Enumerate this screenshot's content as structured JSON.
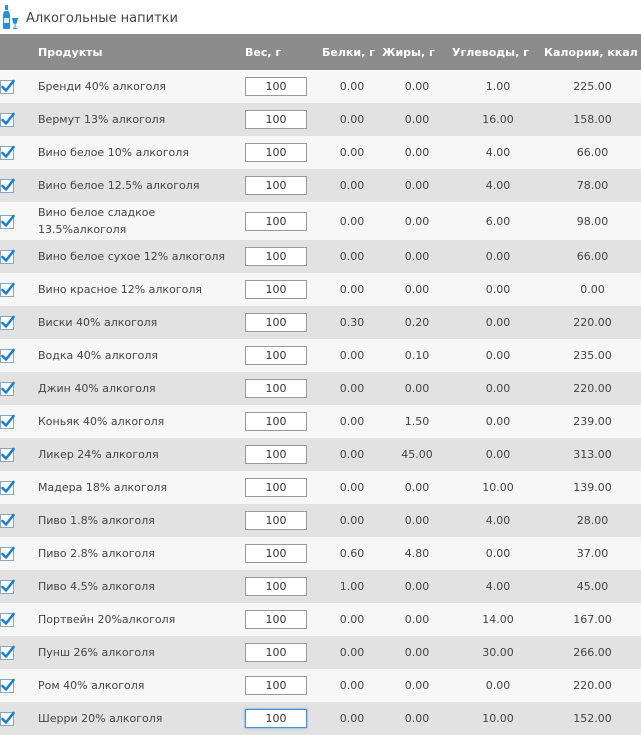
{
  "category": {
    "title": "Алкогольные напитки",
    "icon": "bottle-glass-icon"
  },
  "columns": {
    "product": "Продукты",
    "weight": "Вес, г",
    "protein": "Белки, г",
    "fat": "Жиры, г",
    "carbs": "Углеводы, г",
    "calories": "Калории, ккал"
  },
  "accent_color": "#1a7fd4",
  "rows": [
    {
      "name": "Бренди 40% алкоголя",
      "weight": "100",
      "protein": "0.00",
      "fat": "0.00",
      "carbs": "1.00",
      "calories": "225.00"
    },
    {
      "name": "Вермут 13% алкоголя",
      "weight": "100",
      "protein": "0.00",
      "fat": "0.00",
      "carbs": "16.00",
      "calories": "158.00"
    },
    {
      "name": "Вино белое 10% алкоголя",
      "weight": "100",
      "protein": "0.00",
      "fat": "0.00",
      "carbs": "4.00",
      "calories": "66.00"
    },
    {
      "name": "Вино белое 12.5% алкоголя",
      "weight": "100",
      "protein": "0.00",
      "fat": "0.00",
      "carbs": "4.00",
      "calories": "78.00"
    },
    {
      "name": "Вино белое сладкое 13.5%алкоголя",
      "weight": "100",
      "protein": "0.00",
      "fat": "0.00",
      "carbs": "6.00",
      "calories": "98.00"
    },
    {
      "name": "Вино белое сухое 12% алкоголя",
      "weight": "100",
      "protein": "0.00",
      "fat": "0.00",
      "carbs": "0.00",
      "calories": "66.00"
    },
    {
      "name": "Вино красное 12% алкоголя",
      "weight": "100",
      "protein": "0.00",
      "fat": "0.00",
      "carbs": "0.00",
      "calories": "0.00"
    },
    {
      "name": "Виски 40% алкоголя",
      "weight": "100",
      "protein": "0.30",
      "fat": "0.20",
      "carbs": "0.00",
      "calories": "220.00"
    },
    {
      "name": "Водка 40% алкоголя",
      "weight": "100",
      "protein": "0.00",
      "fat": "0.10",
      "carbs": "0.00",
      "calories": "235.00"
    },
    {
      "name": "Джин 40% алкоголя",
      "weight": "100",
      "protein": "0.00",
      "fat": "0.00",
      "carbs": "0.00",
      "calories": "220.00"
    },
    {
      "name": "Коньяк 40% алкоголя",
      "weight": "100",
      "protein": "0.00",
      "fat": "1.50",
      "carbs": "0.00",
      "calories": "239.00"
    },
    {
      "name": "Ликер 24% алкоголя",
      "weight": "100",
      "protein": "0.00",
      "fat": "45.00",
      "carbs": "0.00",
      "calories": "313.00"
    },
    {
      "name": "Мадера 18% алкоголя",
      "weight": "100",
      "protein": "0.00",
      "fat": "0.00",
      "carbs": "10.00",
      "calories": "139.00"
    },
    {
      "name": "Пиво 1.8% алкоголя",
      "weight": "100",
      "protein": "0.00",
      "fat": "0.00",
      "carbs": "4.00",
      "calories": "28.00"
    },
    {
      "name": "Пиво 2.8% алкоголя",
      "weight": "100",
      "protein": "0.60",
      "fat": "4.80",
      "carbs": "0.00",
      "calories": "37.00"
    },
    {
      "name": "Пиво 4.5% алкоголя",
      "weight": "100",
      "protein": "1.00",
      "fat": "0.00",
      "carbs": "4.00",
      "calories": "45.00"
    },
    {
      "name": "Портвейн 20%алкоголя",
      "weight": "100",
      "protein": "0.00",
      "fat": "0.00",
      "carbs": "14.00",
      "calories": "167.00"
    },
    {
      "name": "Пунш 26% алкоголя",
      "weight": "100",
      "protein": "0.00",
      "fat": "0.00",
      "carbs": "30.00",
      "calories": "266.00"
    },
    {
      "name": "Ром 40% алкоголя",
      "weight": "100",
      "protein": "0.00",
      "fat": "0.00",
      "carbs": "0.00",
      "calories": "220.00"
    },
    {
      "name": "Шерри 20% алкоголя",
      "weight": "100",
      "protein": "0.00",
      "fat": "0.00",
      "carbs": "10.00",
      "calories": "152.00"
    }
  ]
}
